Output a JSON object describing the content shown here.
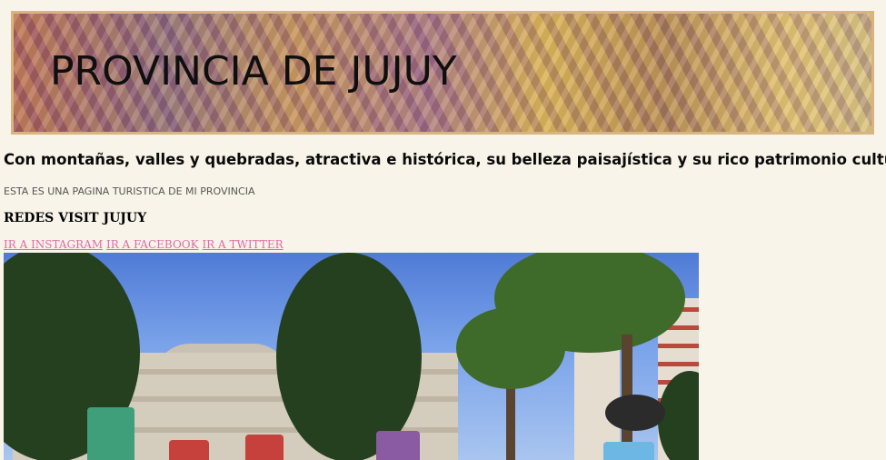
{
  "header": {
    "title": "PROVINCIA DE JUJUY"
  },
  "intro": {
    "lead": "Con montañas, valles y quebradas, atractiva e histórica, su belleza paisajística y su rico patrimonio cultural.",
    "subtitle": "ESTA ES UNA PAGINA TURISTICA DE MI PROVINCIA"
  },
  "social": {
    "heading": "REDES VISIT JUJUY",
    "links": [
      {
        "label": "IR A INSTAGRAM"
      },
      {
        "label": "IR A FACEBOOK"
      },
      {
        "label": "IR A TWITTER"
      }
    ]
  },
  "colors": {
    "background": "#f8f4e9",
    "banner_border": "#d8b57e",
    "link": "#e06aa8"
  }
}
